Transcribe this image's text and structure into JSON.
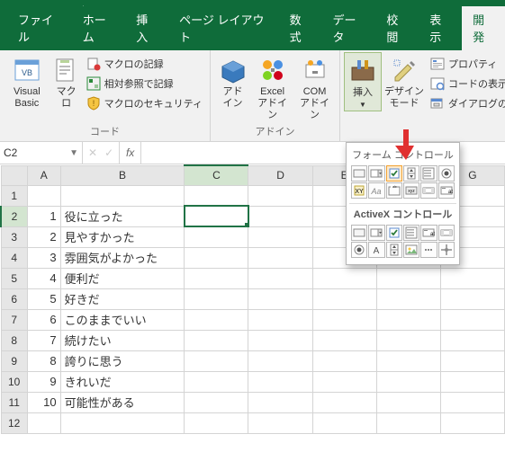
{
  "qat": {
    "save": "save",
    "undo": "undo",
    "redo": "redo"
  },
  "tabs": [
    "ファイル",
    "ホーム",
    "挿入",
    "ページ レイアウト",
    "数式",
    "データ",
    "校閲",
    "表示",
    "開発"
  ],
  "activeTab": "開発",
  "ribbon": {
    "code": {
      "vb": "Visual Basic",
      "macros": "マクロ",
      "record": "マクロの記録",
      "relative": "相対参照で記録",
      "security": "マクロのセキュリティ",
      "label": "コード"
    },
    "addins": {
      "addin": "アド\nイン",
      "excel": "Excel\nアドイン",
      "com": "COM\nアドイン",
      "label": "アドイン"
    },
    "controls": {
      "insert": "挿入",
      "design": "デザイン\nモード",
      "props": "プロパティ",
      "viewcode": "コードの表示",
      "dialog": "ダイアログの実行"
    }
  },
  "namebox": "C2",
  "formula": "",
  "columns": [
    "A",
    "B",
    "C",
    "D",
    "E",
    "F",
    "G"
  ],
  "colWidths": {
    "A": 38,
    "B": 140,
    "C": 76,
    "D": 76,
    "E": 76,
    "F": 76,
    "G": 76
  },
  "rows": [
    {
      "r": 1,
      "A": "",
      "B": ""
    },
    {
      "r": 2,
      "A": "1",
      "B": "役に立った"
    },
    {
      "r": 3,
      "A": "2",
      "B": "見やすかった"
    },
    {
      "r": 4,
      "A": "3",
      "B": "雰囲気がよかった"
    },
    {
      "r": 5,
      "A": "4",
      "B": "便利だ"
    },
    {
      "r": 6,
      "A": "5",
      "B": "好きだ"
    },
    {
      "r": 7,
      "A": "6",
      "B": "このままでいい"
    },
    {
      "r": 8,
      "A": "7",
      "B": "続けたい"
    },
    {
      "r": 9,
      "A": "8",
      "B": "誇りに思う"
    },
    {
      "r": 10,
      "A": "9",
      "B": "きれいだ"
    },
    {
      "r": 11,
      "A": "10",
      "B": "可能性がある"
    },
    {
      "r": 12,
      "A": "",
      "B": ""
    }
  ],
  "activeCell": {
    "row": 2,
    "col": "C"
  },
  "dropdown": {
    "formLabel": "フォーム コントロール",
    "axLabel": "ActiveX コントロール",
    "hotIndex": 2,
    "formIcons": [
      "button",
      "combo",
      "check",
      "spin",
      "list",
      "option",
      "label",
      "aa",
      "groupbox",
      "xyz",
      "scroll",
      "textbox"
    ],
    "axIcons": [
      "button",
      "combo",
      "check",
      "list",
      "textbox",
      "scroll",
      "option",
      "A",
      "spin",
      "image",
      "more",
      "tools"
    ]
  }
}
